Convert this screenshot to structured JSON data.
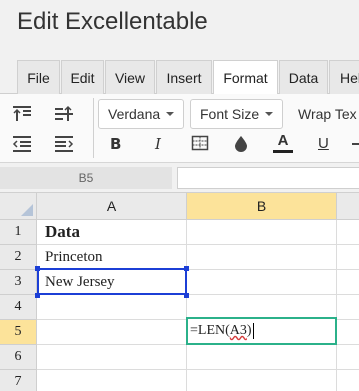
{
  "app": {
    "title": "Edit Excellentable"
  },
  "tabs": [
    {
      "label": "File"
    },
    {
      "label": "Edit"
    },
    {
      "label": "View"
    },
    {
      "label": "Insert"
    },
    {
      "label": "Format",
      "active": true
    },
    {
      "label": "Data"
    },
    {
      "label": "Hel"
    }
  ],
  "toolbar": {
    "font_name": "Verdana",
    "font_size": "Font Size",
    "wrap_text": "Wrap Tex",
    "bold": "B",
    "italic": "I",
    "font_color_glyph": "A",
    "underline": "U",
    "icons": [
      "align-top-icon",
      "align-middle-icon",
      "indent-decrease-icon",
      "indent-increase-icon",
      "borders-icon",
      "fill-color-icon",
      "font-color-icon",
      "underline-icon"
    ],
    "accent_color": "#2bb18a",
    "selection_color": "#1c3fd6"
  },
  "formula_bar": {
    "name_box": "B5",
    "value": ""
  },
  "grid": {
    "columns": [
      "A",
      "B"
    ],
    "selected_column": "B",
    "rows": [
      "1",
      "2",
      "3",
      "4",
      "5",
      "6",
      "7"
    ],
    "selected_row": "5",
    "cells": {
      "A1": "Data",
      "A2": "Princeton",
      "A3": "New Jersey"
    },
    "editing": {
      "cell": "B5",
      "prefix": "=LEN(",
      "reference": "A3",
      "suffix": ")"
    }
  }
}
